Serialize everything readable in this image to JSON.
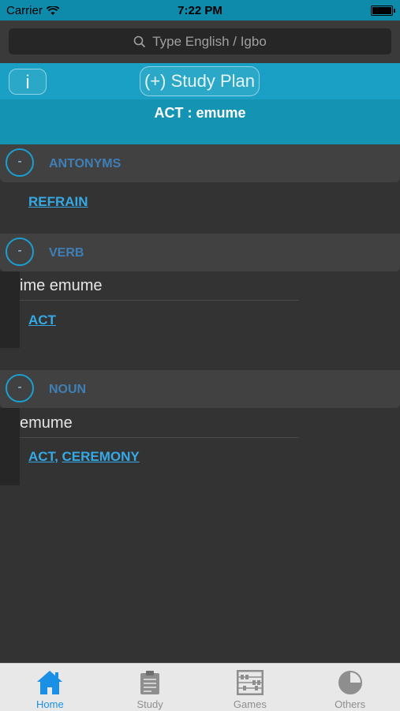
{
  "status_bar": {
    "carrier": "Carrier",
    "time": "7:22 PM"
  },
  "search": {
    "placeholder": "Type English / Igbo"
  },
  "header": {
    "info_label": "i",
    "study_plan_label": "(+) Study Plan",
    "entry_title": "ACT : emume"
  },
  "sections": {
    "antonyms": {
      "toggle": "-",
      "title": "ANTONYMS",
      "links": [
        "REFRAIN"
      ]
    },
    "verb": {
      "toggle": "-",
      "title": "VERB",
      "igbo": "ime emume",
      "links": [
        "ACT"
      ]
    },
    "noun": {
      "toggle": "-",
      "title": "NOUN",
      "igbo": "emume",
      "links": [
        "ACT",
        "CEREMONY"
      ],
      "separator": ", "
    }
  },
  "tabbar": {
    "tabs": [
      {
        "label": "Home",
        "icon": "home-icon",
        "active": true
      },
      {
        "label": "Study",
        "icon": "clipboard-icon",
        "active": false
      },
      {
        "label": "Games",
        "icon": "abacus-icon",
        "active": false
      },
      {
        "label": "Others",
        "icon": "pie-icon",
        "active": false
      }
    ]
  },
  "colors": {
    "accent": "#1aa0c4",
    "link": "#35a9e6",
    "section_label": "#3f7fb6",
    "active_tab": "#1a8fe6"
  }
}
